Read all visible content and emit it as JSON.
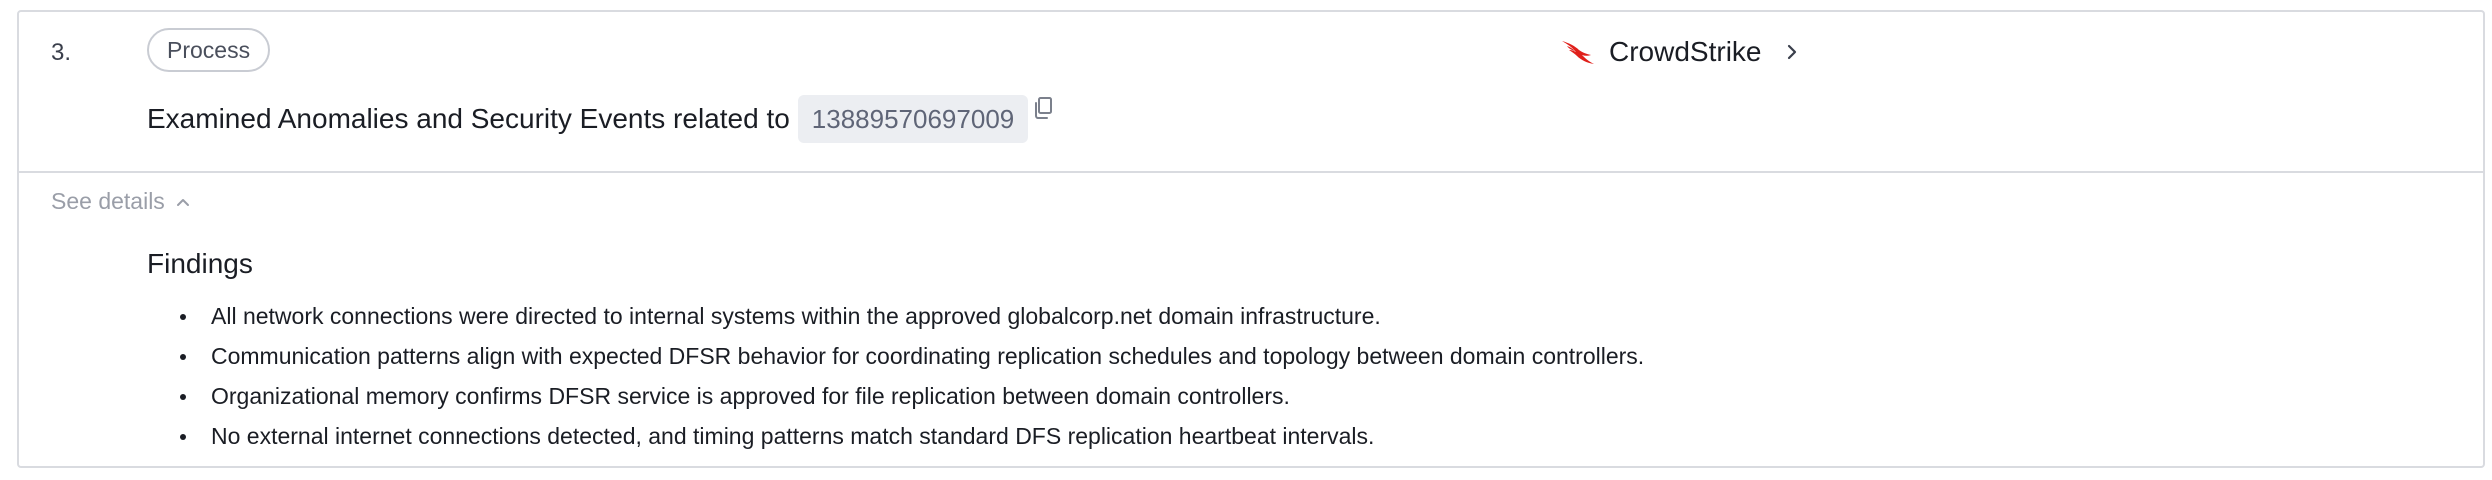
{
  "step": {
    "number": "3.",
    "type_label": "Process",
    "title": "Examined Anomalies and Security Events related to",
    "entity_id": "13889570697009"
  },
  "source": {
    "name": "CrowdStrike",
    "icon": "falcon-icon",
    "brand_color": "#e0201b"
  },
  "details": {
    "toggle_label": "See details",
    "expanded": true,
    "heading": "Findings",
    "items": [
      "All network connections were directed to internal systems within the approved globalcorp.net domain infrastructure.",
      "Communication patterns align with expected DFSR behavior for coordinating replication schedules and topology between domain controllers.",
      "Organizational memory confirms DFSR service is approved for file replication between domain controllers.",
      "No external internet connections detected, and timing patterns match standard DFS replication heartbeat intervals."
    ]
  },
  "colors": {
    "border": "#d9dbe0",
    "muted_text": "#9a9ea8",
    "chip_bg": "#eceef2"
  }
}
